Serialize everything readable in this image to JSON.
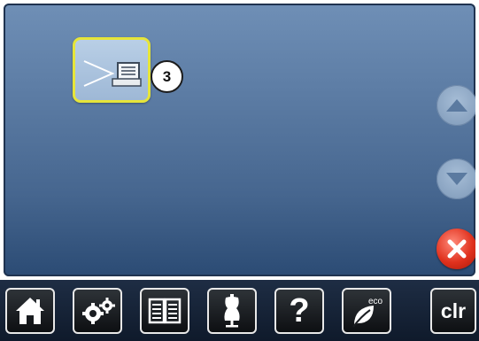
{
  "main": {
    "tile": {
      "icon": "threading-program-icon"
    },
    "badge": {
      "number": "3"
    },
    "controls": {
      "up": "arrow-up-icon",
      "down": "arrow-down-icon",
      "close": "close-icon"
    }
  },
  "bottom_bar": {
    "items": [
      {
        "icon": "home-icon"
      },
      {
        "icon": "settings-gears-icon"
      },
      {
        "icon": "manual-book-icon"
      },
      {
        "icon": "dress-form-icon"
      },
      {
        "icon": "help-icon",
        "label": "?"
      },
      {
        "icon": "eco-leaf-icon",
        "label": "eco"
      },
      {
        "icon": "clear-icon",
        "label": "clr"
      }
    ]
  },
  "colors": {
    "tile_border": "#e6e53a",
    "close_red": "#e0311d",
    "screen_top": "#6f8fb6",
    "screen_bottom": "#2b4b74"
  }
}
